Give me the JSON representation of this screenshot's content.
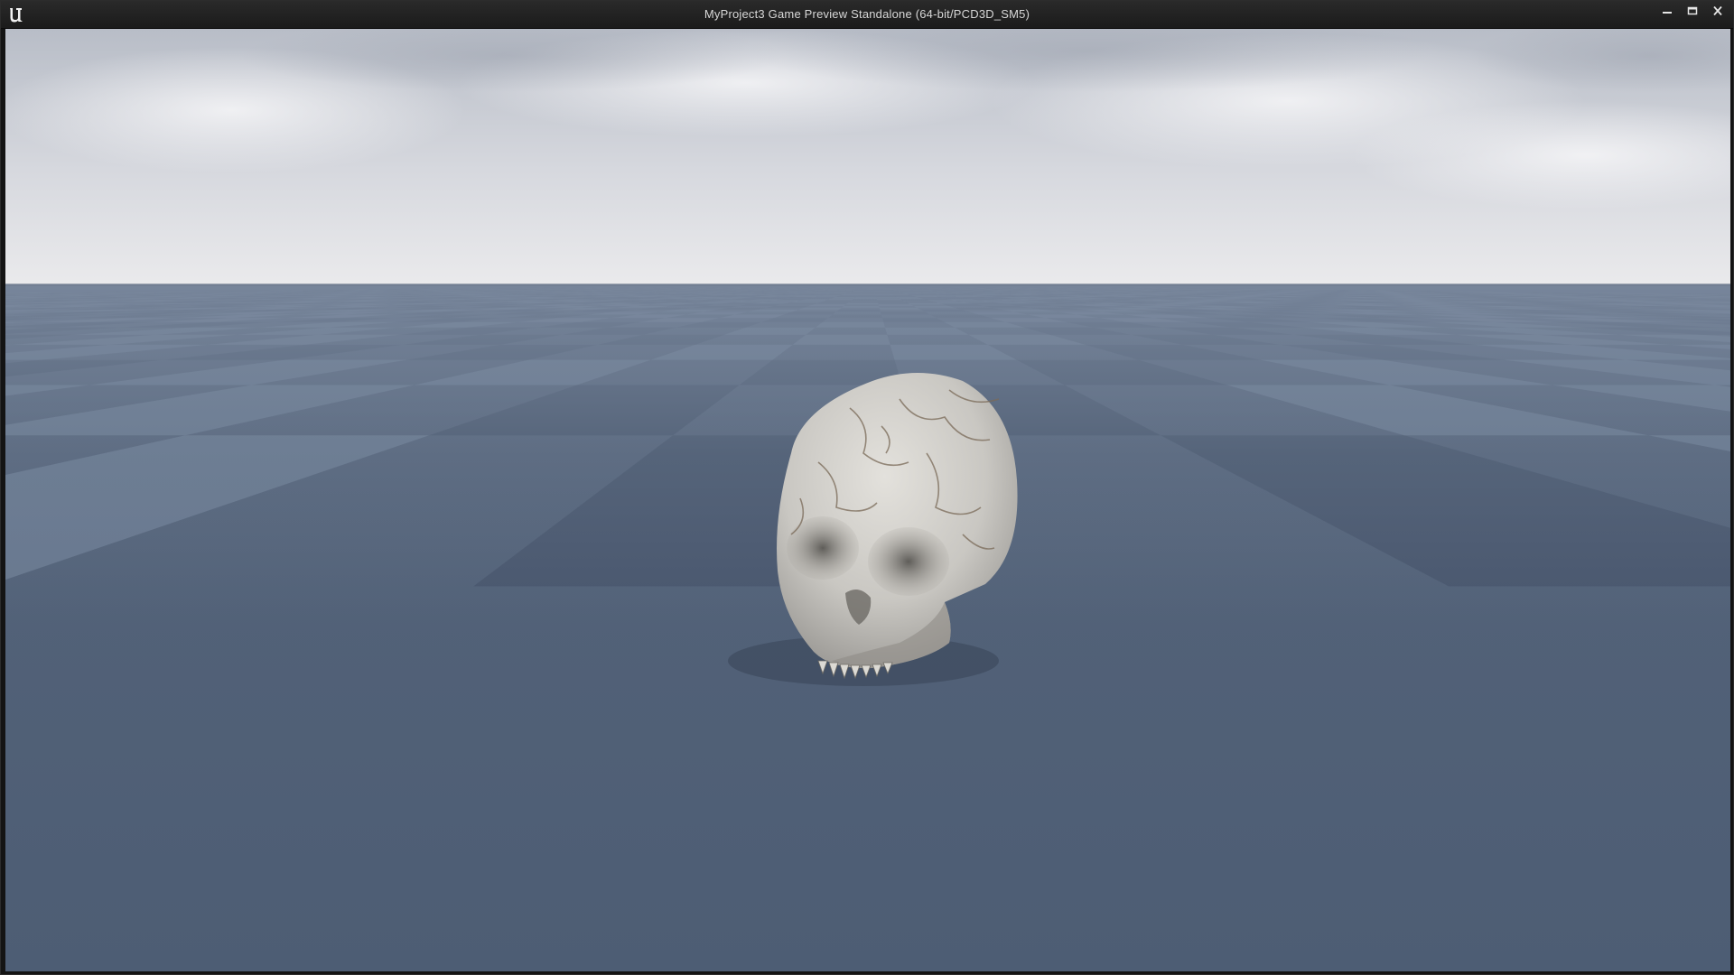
{
  "window": {
    "title": "MyProject3 Game Preview Standalone (64-bit/PCD3D_SM5)",
    "logo_icon": "unreal-engine-logo-icon",
    "controls": [
      {
        "name": "minimize-button",
        "icon": "minimize-icon"
      },
      {
        "name": "maximize-button",
        "icon": "maximize-icon"
      },
      {
        "name": "close-button",
        "icon": "close-icon"
      }
    ]
  },
  "viewport": {
    "sky_top": "#b9bec8",
    "sky_bottom": "#e7e7ea",
    "floor_light": "#6c7d93",
    "floor_dark": "#46556b",
    "object": "skull"
  }
}
